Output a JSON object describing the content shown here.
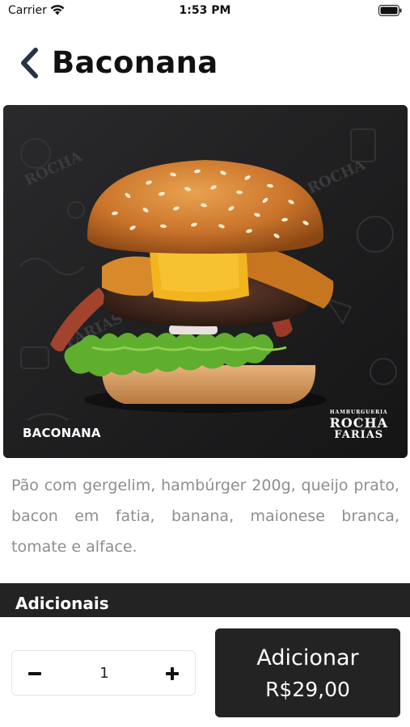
{
  "status_bar": {
    "carrier": "Carrier",
    "time": "1:53 PM"
  },
  "header": {
    "title": "Baconana",
    "back_icon": "chevron-left-icon"
  },
  "hero": {
    "caption": "BACONANA",
    "logo_small": "HAMBURGUERIA",
    "logo_line1": "ROCHA",
    "logo_line2": "FARIAS"
  },
  "product": {
    "description": "Pão com gergelim, hambúrger 200g, queijo prato, bacon em fatia, banana, maionese branca, tomate e alface."
  },
  "section": {
    "title": "Adicionais"
  },
  "footer": {
    "quantity": "1",
    "minus_icon": "minus-icon",
    "plus_icon": "plus-icon",
    "add_label": "Adicionar",
    "price": "R$29,00"
  },
  "colors": {
    "dark": "#232323",
    "text_muted": "#8e8e93",
    "background": "#ffffff"
  }
}
